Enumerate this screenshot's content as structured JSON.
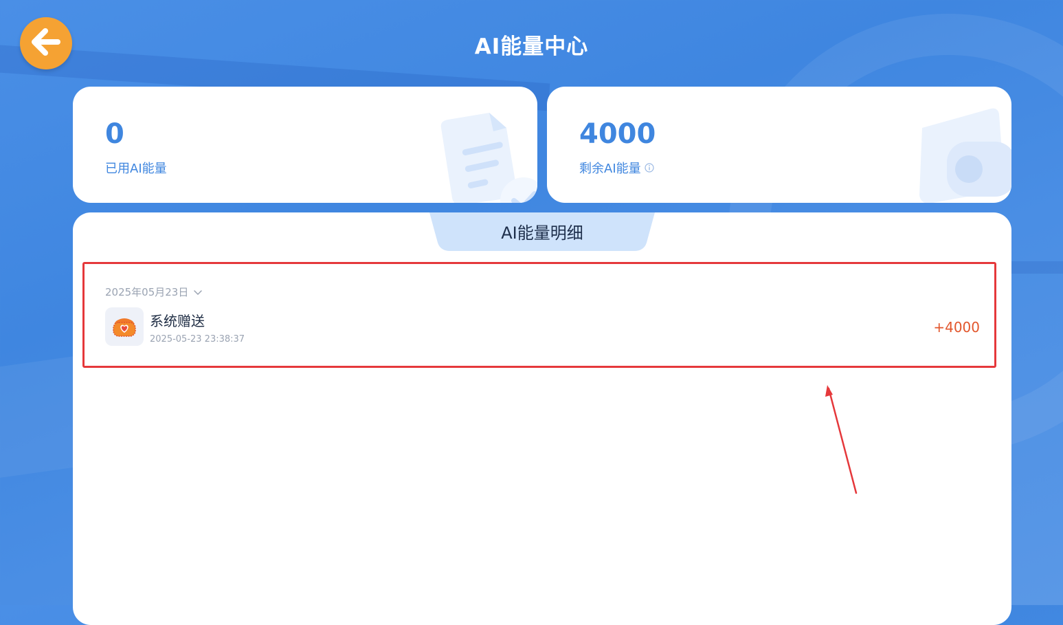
{
  "header": {
    "title": "AI能量中心",
    "back_icon": "arrow-left-icon"
  },
  "stats": {
    "used": {
      "value": "0",
      "label": "已用AI能量"
    },
    "remaining": {
      "value": "4000",
      "label": "剩余AI能量",
      "icon": "info-icon"
    }
  },
  "detail": {
    "tab_label": "AI能量明细",
    "records": [
      {
        "date_group": "2025年05月23日",
        "title": "系统赠送",
        "time": "2025-05-23 23:38:37",
        "amount": "+4000",
        "icon": "gift-wallet-icon"
      }
    ]
  },
  "colors": {
    "accent_blue": "#3f86df",
    "back_button": "#f5a233",
    "amount": "#e2562c",
    "highlight_border": "#e5383b"
  }
}
